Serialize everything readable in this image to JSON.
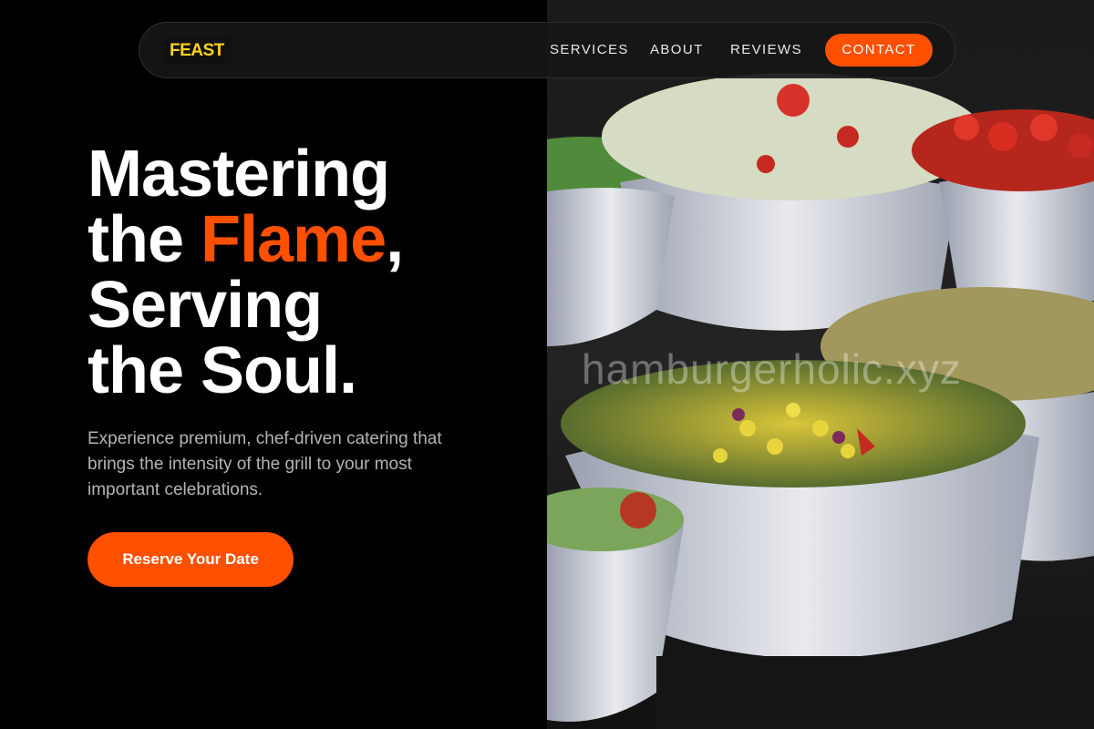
{
  "brand": {
    "logo": "FEAST"
  },
  "nav": {
    "links": [
      "SERVICES",
      "ABOUT",
      "REVIEWS"
    ],
    "cta": "CONTACT"
  },
  "hero": {
    "title_line1": "Mastering",
    "title_line2_pre": "the ",
    "title_accent": "Flame",
    "title_line2_post": ",",
    "title_line3": "Serving",
    "title_line4": "the Soul.",
    "description": "Experience premium, chef-driven catering that brings the intensity of the grill to your most important celebrations.",
    "cta": "Reserve Your Date"
  },
  "image": {
    "watermark": "hamburgerholic.xyz"
  },
  "colors": {
    "accent": "#ff5000",
    "logo": "#ffd21f",
    "background": "#000000"
  }
}
